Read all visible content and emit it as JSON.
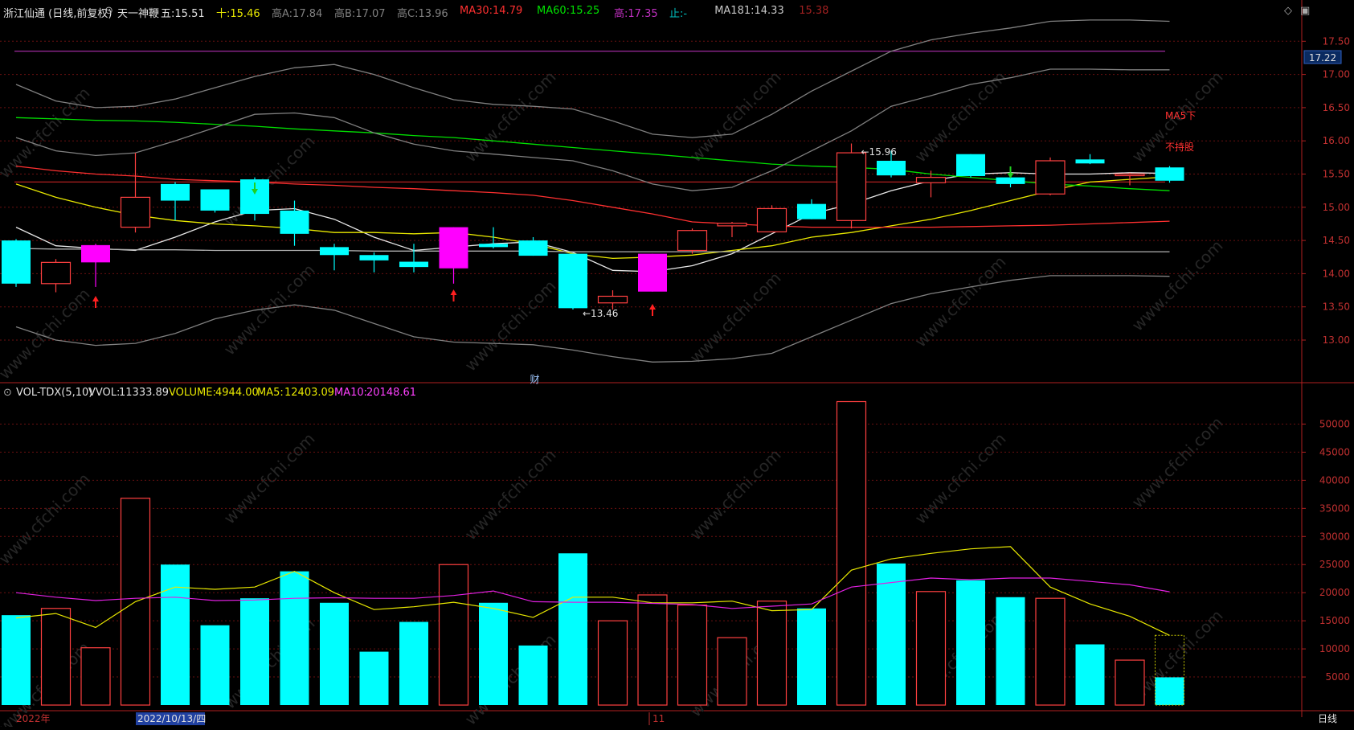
{
  "header": {
    "title": "浙江仙通 (日线,前复权)",
    "indicator": "天一神鞭",
    "fields": [
      {
        "label": "五:",
        "value": "15.51",
        "color": "#e0e0e0"
      },
      {
        "label": "十:",
        "value": "15.46",
        "color": "#e8e800"
      },
      {
        "label": "高A:",
        "value": "17.84",
        "color": "#808080"
      },
      {
        "label": "高B:",
        "value": "17.07",
        "color": "#808080"
      },
      {
        "label": "高C:",
        "value": "13.96",
        "color": "#808080"
      },
      {
        "label": "MA30:",
        "value": "14.79",
        "color": "#ff3030"
      },
      {
        "label": "MA60:",
        "value": "15.25",
        "color": "#00e000"
      },
      {
        "label": "高:",
        "value": "17.35",
        "color": "#c030c0"
      },
      {
        "label": "止:",
        "value": "-",
        "color": "#00c0c0"
      },
      {
        "label": "MA181:",
        "value": "14.33",
        "color": "#c8c8c8"
      },
      {
        "label": "",
        "value": "15.38",
        "color": "#a02020"
      }
    ]
  },
  "volume_header": {
    "name": "VOL-TDX(5,10)",
    "vvol_label": "VVOL:",
    "vvol_value": "11333.89",
    "volume_label": "VOLUME:",
    "volume_value": "4944.00",
    "ma5_label": "MA5:",
    "ma5_value": "12403.09",
    "ma10_label": "MA10:",
    "ma10_value": "20148.61"
  },
  "footer": {
    "year_label": "2022年",
    "date_label": "2022/10/13/四",
    "month_label": "11",
    "period_label": "日线"
  },
  "annotations": {
    "high_label": "←15.96",
    "low_label": "←13.46",
    "cai_label": "财",
    "ma5_down": "MA5下",
    "not_hold": "不持股",
    "price_tag": "17.22"
  },
  "watermark": "www.cfchi.com",
  "colors": {
    "up": "#ff4040",
    "down": "#00ffff",
    "bg": "#000000",
    "grid": "#7a1010",
    "magenta": "#ff00ff"
  },
  "chart_data": [
    {
      "type": "candlestick",
      "ylim": [
        12.7,
        17.7
      ],
      "yticks": [
        "13.00",
        "13.50",
        "14.00",
        "14.50",
        "15.00",
        "15.50",
        "16.00",
        "16.50",
        "17.00",
        "17.50"
      ],
      "candles": [
        {
          "o": 14.5,
          "h": 14.52,
          "l": 13.8,
          "c": 13.85,
          "kind": "down"
        },
        {
          "o": 13.85,
          "h": 14.22,
          "l": 13.72,
          "c": 14.17,
          "kind": "up"
        },
        {
          "o": 14.17,
          "h": 14.45,
          "l": 13.8,
          "c": 14.43,
          "kind": "magenta"
        },
        {
          "o": 14.7,
          "h": 15.82,
          "l": 14.62,
          "c": 15.15,
          "kind": "up"
        },
        {
          "o": 15.35,
          "h": 15.38,
          "l": 14.8,
          "c": 15.1,
          "kind": "down"
        },
        {
          "o": 15.27,
          "h": 15.27,
          "l": 14.92,
          "c": 14.95,
          "kind": "down"
        },
        {
          "o": 15.42,
          "h": 15.45,
          "l": 14.8,
          "c": 14.9,
          "kind": "down"
        },
        {
          "o": 14.95,
          "h": 15.1,
          "l": 14.42,
          "c": 14.6,
          "kind": "down"
        },
        {
          "o": 14.4,
          "h": 14.45,
          "l": 14.05,
          "c": 14.28,
          "kind": "down"
        },
        {
          "o": 14.28,
          "h": 14.32,
          "l": 14.02,
          "c": 14.2,
          "kind": "down"
        },
        {
          "o": 14.18,
          "h": 14.45,
          "l": 14.02,
          "c": 14.1,
          "kind": "down"
        },
        {
          "o": 14.08,
          "h": 14.7,
          "l": 13.85,
          "c": 14.7,
          "kind": "magenta"
        },
        {
          "o": 14.45,
          "h": 14.7,
          "l": 14.38,
          "c": 14.4,
          "kind": "down"
        },
        {
          "o": 14.5,
          "h": 14.55,
          "l": 14.27,
          "c": 14.27,
          "kind": "down"
        },
        {
          "o": 14.3,
          "h": 14.3,
          "l": 13.46,
          "c": 13.48,
          "kind": "down"
        },
        {
          "o": 13.56,
          "h": 13.75,
          "l": 13.46,
          "c": 13.66,
          "kind": "up"
        },
        {
          "o": 13.73,
          "h": 14.3,
          "l": 13.73,
          "c": 14.3,
          "kind": "magenta"
        },
        {
          "o": 14.35,
          "h": 14.68,
          "l": 14.3,
          "c": 14.65,
          "kind": "up"
        },
        {
          "o": 14.76,
          "h": 14.78,
          "l": 14.55,
          "c": 14.72,
          "kind": "up"
        },
        {
          "o": 14.63,
          "h": 15.03,
          "l": 14.63,
          "c": 14.98,
          "kind": "up"
        },
        {
          "o": 15.05,
          "h": 15.12,
          "l": 14.82,
          "c": 14.82,
          "kind": "down"
        },
        {
          "o": 14.8,
          "h": 15.96,
          "l": 14.68,
          "c": 15.82,
          "kind": "up"
        },
        {
          "o": 15.7,
          "h": 15.85,
          "l": 15.45,
          "c": 15.48,
          "kind": "down"
        },
        {
          "o": 15.37,
          "h": 15.55,
          "l": 15.15,
          "c": 15.45,
          "kind": "up"
        },
        {
          "o": 15.8,
          "h": 15.8,
          "l": 15.45,
          "c": 15.47,
          "kind": "down"
        },
        {
          "o": 15.45,
          "h": 15.55,
          "l": 15.3,
          "c": 15.35,
          "kind": "down"
        },
        {
          "o": 15.2,
          "h": 15.75,
          "l": 15.18,
          "c": 15.7,
          "kind": "up"
        },
        {
          "o": 15.72,
          "h": 15.8,
          "l": 15.65,
          "c": 15.66,
          "kind": "down"
        },
        {
          "o": 15.5,
          "h": 15.52,
          "l": 15.33,
          "c": 15.5,
          "kind": "up"
        },
        {
          "o": 15.6,
          "h": 15.62,
          "l": 15.37,
          "c": 15.4,
          "kind": "down"
        }
      ],
      "lines": [
        {
          "name": "五",
          "color": "#e8e8e8",
          "values": [
            14.7,
            14.42,
            14.38,
            14.35,
            14.55,
            14.78,
            14.95,
            14.98,
            14.82,
            14.55,
            14.35,
            14.4,
            14.45,
            14.48,
            14.32,
            14.05,
            14.03,
            14.12,
            14.3,
            14.6,
            14.9,
            15.05,
            15.25,
            15.4,
            15.5,
            15.52,
            15.5,
            15.5,
            15.52,
            15.51
          ]
        },
        {
          "name": "十",
          "color": "#e8e800",
          "values": [
            15.35,
            15.15,
            15.0,
            14.88,
            14.8,
            14.75,
            14.72,
            14.68,
            14.62,
            14.62,
            14.6,
            14.62,
            14.55,
            14.45,
            14.3,
            14.23,
            14.25,
            14.28,
            14.35,
            14.42,
            14.55,
            14.62,
            14.72,
            14.82,
            14.95,
            15.1,
            15.25,
            15.38,
            15.42,
            15.46
          ]
        },
        {
          "name": "MA30",
          "color": "#ff3030",
          "values": [
            15.62,
            15.55,
            15.5,
            15.47,
            15.42,
            15.4,
            15.38,
            15.35,
            15.33,
            15.3,
            15.28,
            15.25,
            15.22,
            15.18,
            15.1,
            15.0,
            14.9,
            14.78,
            14.75,
            14.72,
            14.7,
            14.7,
            14.7,
            14.7,
            14.71,
            14.72,
            14.73,
            14.75,
            14.77,
            14.79
          ]
        },
        {
          "name": "MA60",
          "color": "#00e000",
          "values": [
            16.35,
            16.33,
            16.31,
            16.3,
            16.28,
            16.25,
            16.22,
            16.18,
            16.15,
            16.12,
            16.08,
            16.05,
            16.0,
            15.95,
            15.9,
            15.85,
            15.8,
            15.75,
            15.7,
            15.65,
            15.62,
            15.6,
            15.57,
            15.5,
            15.45,
            15.4,
            15.35,
            15.32,
            15.28,
            15.25
          ]
        },
        {
          "name": "MA181",
          "color": "#b0b0b0",
          "values": [
            14.38,
            14.37,
            14.37,
            14.36,
            14.36,
            14.35,
            14.35,
            14.35,
            14.35,
            14.34,
            14.34,
            14.34,
            14.34,
            14.34,
            14.33,
            14.33,
            14.33,
            14.33,
            14.33,
            14.33,
            14.33,
            14.33,
            14.33,
            14.33,
            14.33,
            14.33,
            14.33,
            14.33,
            14.33,
            14.33
          ]
        },
        {
          "name": "高A",
          "color": "#808080",
          "values": [
            16.85,
            16.6,
            16.5,
            16.52,
            16.63,
            16.8,
            16.97,
            17.1,
            17.15,
            17.0,
            16.8,
            16.62,
            16.55,
            16.52,
            16.48,
            16.3,
            16.1,
            16.05,
            16.1,
            16.4,
            16.75,
            17.05,
            17.35,
            17.52,
            17.62,
            17.7,
            17.8,
            17.82,
            17.82,
            17.8
          ]
        },
        {
          "name": "高B",
          "color": "#808080",
          "values": [
            16.05,
            15.85,
            15.78,
            15.82,
            16.0,
            16.2,
            16.4,
            16.42,
            16.35,
            16.12,
            15.95,
            15.85,
            15.8,
            15.75,
            15.7,
            15.55,
            15.35,
            15.25,
            15.3,
            15.55,
            15.85,
            16.15,
            16.52,
            16.68,
            16.85,
            16.95,
            17.08,
            17.08,
            17.07,
            17.07
          ]
        },
        {
          "name": "高C",
          "color": "#808080",
          "values": [
            13.2,
            13.0,
            12.92,
            12.95,
            13.1,
            13.32,
            13.45,
            13.53,
            13.45,
            13.25,
            13.05,
            12.97,
            12.95,
            12.93,
            12.85,
            12.75,
            12.67,
            12.68,
            12.72,
            12.8,
            13.05,
            13.3,
            13.55,
            13.7,
            13.8,
            13.9,
            13.97,
            13.97,
            13.97,
            13.96
          ]
        }
      ],
      "purple_level": 17.35,
      "red_level": 15.38
    },
    {
      "type": "bar",
      "name": "volume",
      "ylim": [
        0,
        55000
      ],
      "yticks": [
        "5000",
        "10000",
        "15000",
        "20000",
        "25000",
        "30000",
        "35000",
        "40000",
        "45000",
        "50000"
      ],
      "values": [
        16000,
        17200,
        10200,
        36800,
        25000,
        14200,
        19000,
        23800,
        18200,
        9500,
        14800,
        25000,
        18200,
        10600,
        27000,
        15000,
        19600,
        17800,
        12000,
        18500,
        17200,
        54000,
        25200,
        20200,
        22200,
        19200,
        19000,
        10800,
        8000,
        4944
      ],
      "kinds": [
        "down",
        "up",
        "up",
        "up",
        "down",
        "down",
        "down",
        "down",
        "down",
        "down",
        "down",
        "up",
        "down",
        "down",
        "down",
        "up",
        "up",
        "up",
        "up",
        "up",
        "down",
        "up",
        "down",
        "up",
        "down",
        "down",
        "up",
        "down",
        "up",
        "down"
      ],
      "ma5": [
        15500,
        16300,
        13800,
        18400,
        21000,
        20600,
        21000,
        23800,
        20000,
        17000,
        17500,
        18300,
        17200,
        15600,
        19200,
        19200,
        18200,
        18200,
        18500,
        16800,
        17000,
        24000,
        26000,
        27000,
        27800,
        28200,
        21000,
        18000,
        15800,
        12403
      ],
      "ma10": [
        20000,
        19200,
        18600,
        19000,
        19200,
        18600,
        18700,
        19000,
        19100,
        19000,
        19000,
        19500,
        20300,
        18400,
        18300,
        18300,
        18100,
        17900,
        17200,
        17600,
        18000,
        21000,
        21800,
        22600,
        22300,
        22600,
        22600,
        22000,
        21400,
        20149
      ]
    }
  ]
}
